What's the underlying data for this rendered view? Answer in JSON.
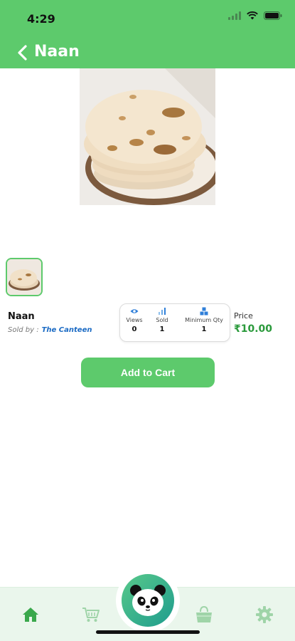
{
  "status_bar": {
    "time": "4:29"
  },
  "header": {
    "title": "Naan"
  },
  "product": {
    "name": "Naan",
    "sold_by_label": "Sold by :",
    "seller": "The Canteen",
    "price_label": "Price",
    "price": "₹10.00"
  },
  "stats": {
    "views": {
      "label": "Views",
      "value": "0"
    },
    "sold": {
      "label": "Sold",
      "value": "1"
    },
    "min_qty": {
      "label": "Minimum Qty",
      "value": "1"
    }
  },
  "actions": {
    "add_to_cart": "Add to Cart"
  },
  "tabbar": {
    "icons": [
      "home-icon",
      "cart-icon",
      "panda-icon",
      "shopping-bag-icon",
      "gear-icon"
    ]
  },
  "colors": {
    "brand_green": "#5dca6c",
    "price_green": "#2b9a3c",
    "seller_blue": "#1c6bc4"
  }
}
